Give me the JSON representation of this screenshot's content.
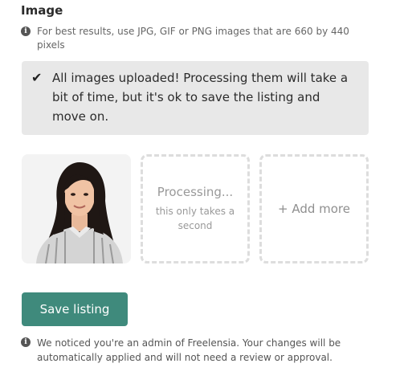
{
  "section": {
    "title": "Image"
  },
  "hint": {
    "icon": "info-icon",
    "text": "For best results, use JPG, GIF or PNG images that are 660 by 440 pixels"
  },
  "alert": {
    "icon": "checkmark-icon",
    "text": "All images uploaded! Processing them will take a bit of time, but it's ok to save the listing and move on."
  },
  "tiles": {
    "processing_title": "Processing...",
    "processing_subtitle": "this only takes a second",
    "add_more_label": "+ Add more"
  },
  "actions": {
    "save_label": "Save listing"
  },
  "notice": {
    "icon": "info-icon",
    "text": "We noticed you're an admin of Freelensia. Your changes will be automatically applied and will not need a review or approval."
  },
  "colors": {
    "primary_button": "#3f8a7c",
    "alert_background": "#e8e8e8",
    "dashed_border": "#dddddd"
  }
}
